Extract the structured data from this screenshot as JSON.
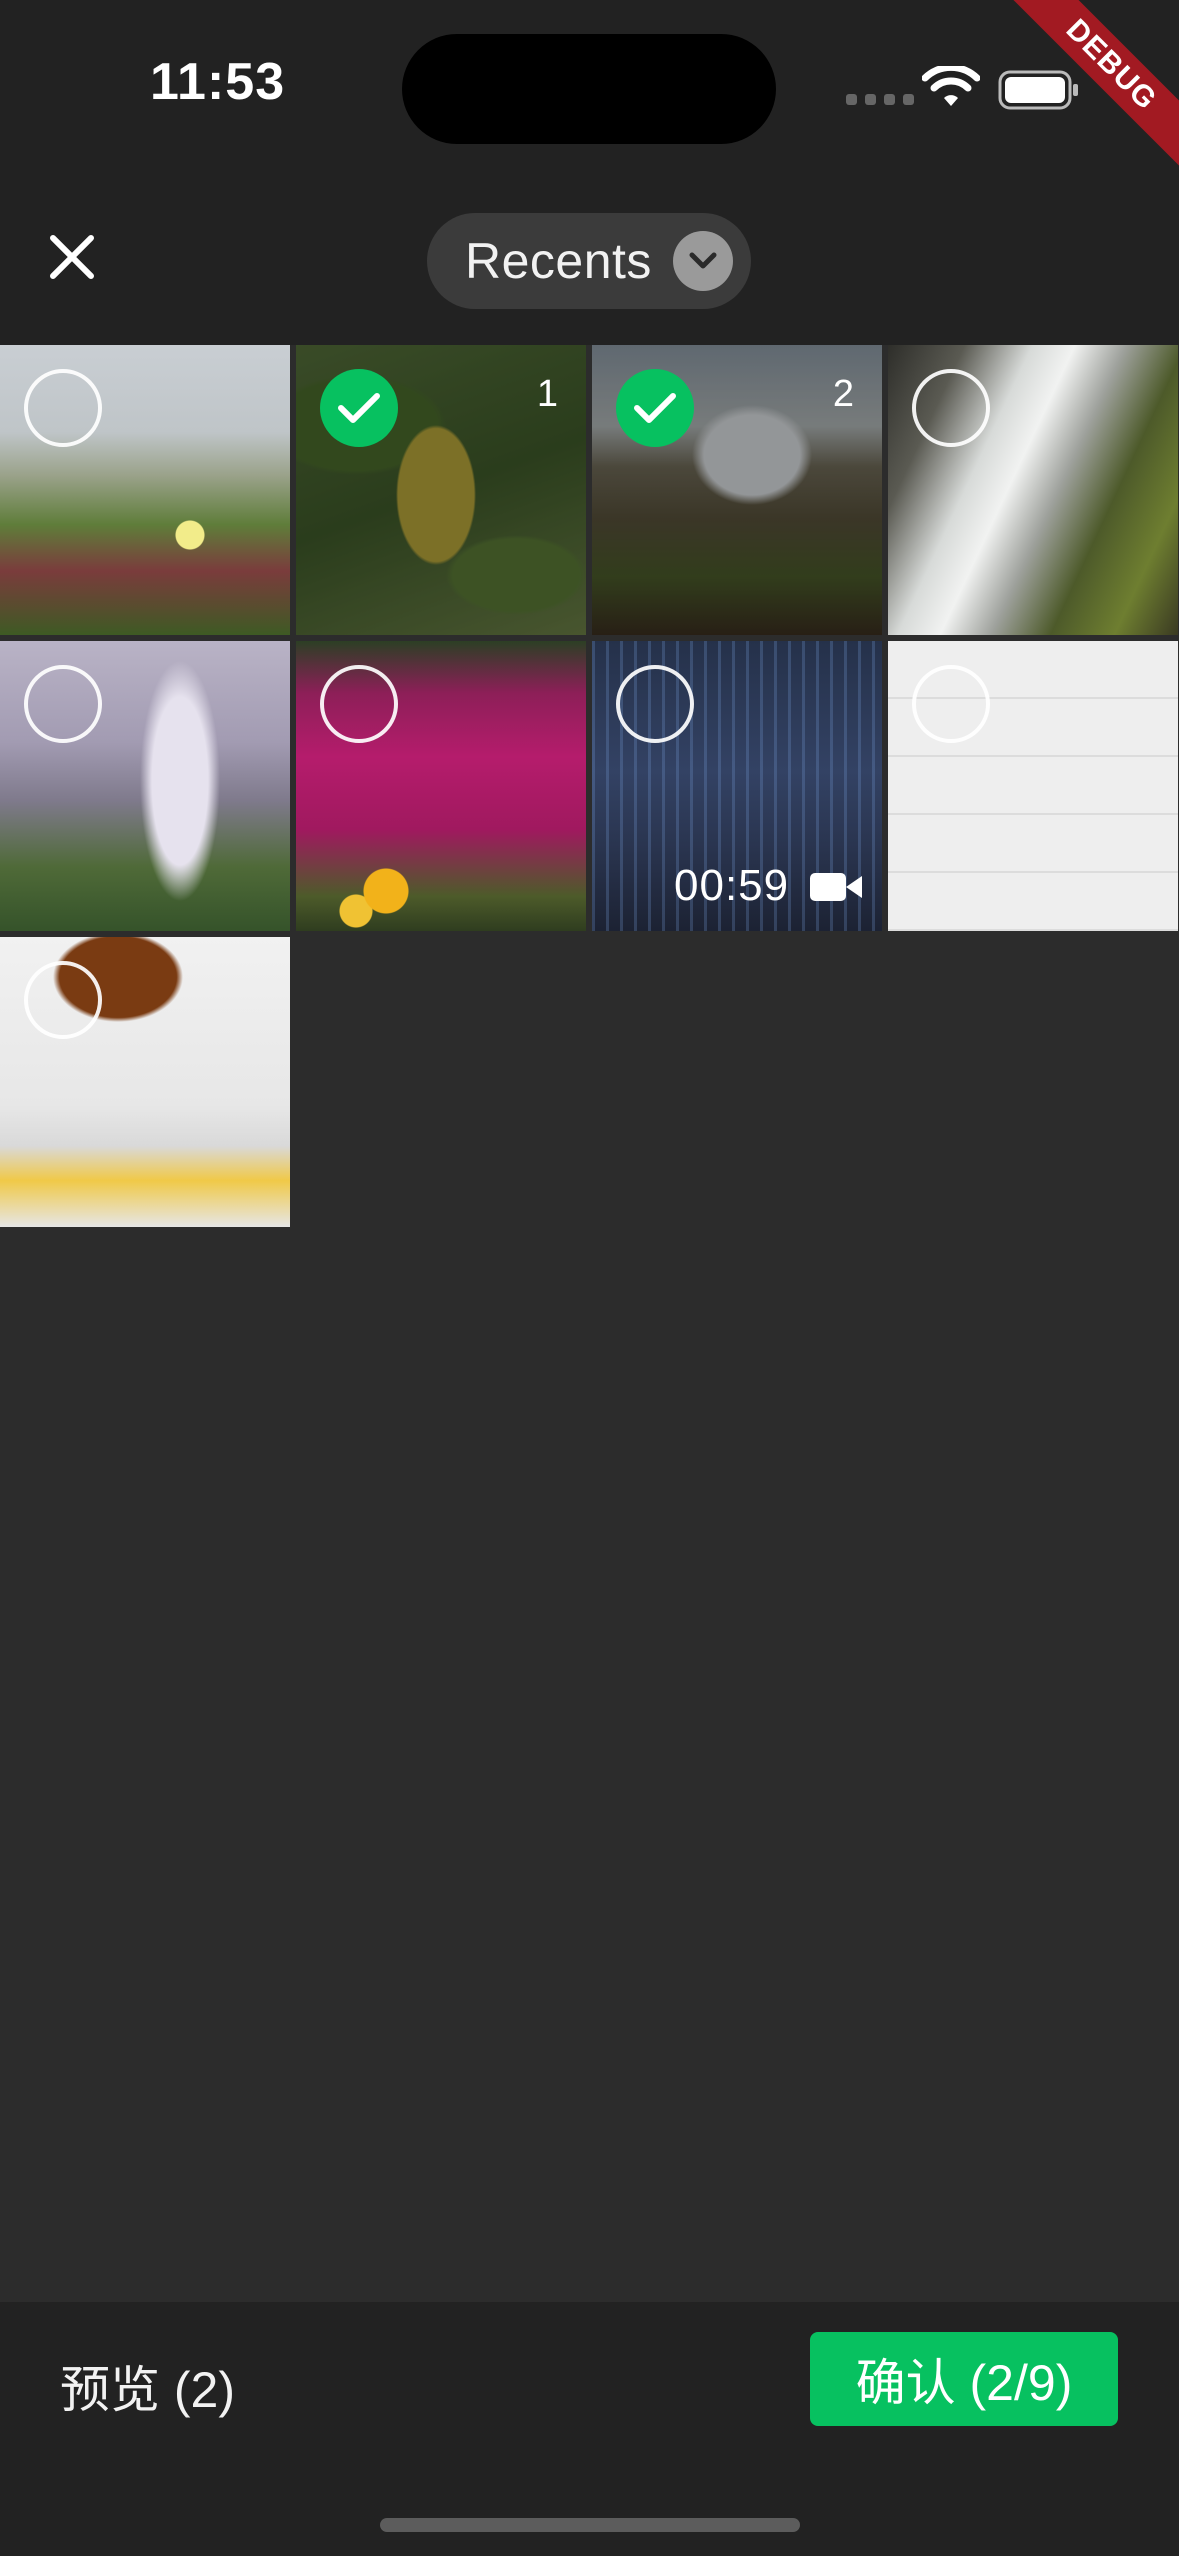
{
  "status_bar": {
    "time": "11:53",
    "debug_label": "DEBUG"
  },
  "header": {
    "album_label": "Recents"
  },
  "grid": {
    "tiles": [
      {
        "selected": false,
        "order": ""
      },
      {
        "selected": true,
        "order": "1"
      },
      {
        "selected": true,
        "order": "2"
      },
      {
        "selected": false,
        "order": ""
      },
      {
        "selected": false,
        "order": ""
      },
      {
        "selected": false,
        "order": ""
      },
      {
        "selected": false,
        "order": "",
        "video_duration": "00:59"
      },
      {
        "selected": false,
        "order": ""
      },
      {
        "selected": false,
        "order": ""
      }
    ]
  },
  "footer": {
    "preview_label": "预览 (2)",
    "confirm_label": "确认 (2/9)"
  },
  "colors": {
    "accent": "#07c160",
    "background": "#2c2c2c",
    "bar": "#222222"
  }
}
